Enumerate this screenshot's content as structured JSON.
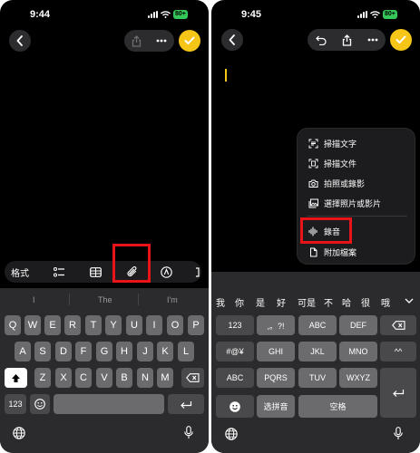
{
  "left": {
    "time": "9:44",
    "battery": "80+",
    "toolbar": {
      "format_label": "格式"
    },
    "suggestions": [
      "I",
      "The",
      "I'm"
    ],
    "rows": [
      [
        "Q",
        "W",
        "E",
        "R",
        "T",
        "Y",
        "U",
        "I",
        "O",
        "P"
      ],
      [
        "A",
        "S",
        "D",
        "F",
        "G",
        "H",
        "J",
        "K",
        "L"
      ],
      [
        "Z",
        "X",
        "C",
        "V",
        "B",
        "N",
        "M"
      ]
    ],
    "numbers_key": "123"
  },
  "right": {
    "time": "9:45",
    "battery": "80+",
    "menu": {
      "items": [
        {
          "label": "掃描文字",
          "icon": "scan-text-icon"
        },
        {
          "label": "掃描文件",
          "icon": "scan-document-icon"
        },
        {
          "label": "拍照或錄影",
          "icon": "camera-icon"
        },
        {
          "label": "選擇照片或影片",
          "icon": "photo-library-icon"
        },
        {
          "label": "錄音",
          "icon": "waveform-icon"
        },
        {
          "label": "附加檔案",
          "icon": "document-icon"
        }
      ]
    },
    "candidates": [
      "我",
      "你",
      "是",
      "好",
      "可是",
      "不",
      "哈",
      "很",
      "哦"
    ],
    "keys": {
      "row1": [
        "123",
        ",。?!",
        "ABC",
        "DEF"
      ],
      "row2": [
        "#@¥",
        "GHI",
        "JKL",
        "MNO",
        "^^"
      ],
      "row3": [
        "ABC",
        "PQRS",
        "TUV",
        "WXYZ"
      ],
      "row4_pinyin": "选拼音",
      "row4_space": "空格"
    }
  },
  "colors": {
    "accent": "#f5c518",
    "highlight": "#e8141a"
  }
}
